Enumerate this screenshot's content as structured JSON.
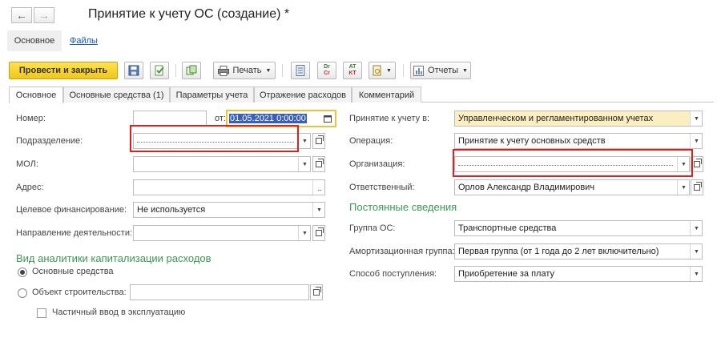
{
  "window": {
    "title": "Принятие к учету ОС (создание) *"
  },
  "doc_nav": {
    "main": "Основное",
    "files": "Файлы"
  },
  "toolbar": {
    "post_and_close": "Провести и закрыть",
    "print": "Печать",
    "dr_label": "Dr",
    "cr_label": "Cr",
    "at_label": "AT",
    "kt_label": "KT",
    "reports": "Отчеты"
  },
  "tabs": [
    {
      "label": "Основное"
    },
    {
      "label": "Основные средства (1)"
    },
    {
      "label": "Параметры учета"
    },
    {
      "label": "Отражение расходов"
    },
    {
      "label": "Комментарий"
    }
  ],
  "form": {
    "number_label": "Номер:",
    "number_value": "",
    "from_label": "от:",
    "date_value": "01.05.2021  0:00:00",
    "department_label": "Подразделение:",
    "department_value": "",
    "mol_label": "МОЛ:",
    "mol_value": "",
    "address_label": "Адрес:",
    "address_value": "",
    "financing_label": "Целевое финансирование:",
    "financing_value": "Не используется",
    "direction_label": "Направление деятельности:",
    "direction_value": "",
    "analytics_title": "Вид аналитики капитализации расходов",
    "radio_fixed_assets": "Основные средства",
    "radio_construction": "Объект строительства:",
    "construction_value": "",
    "partial_commissioning": "Частичный ввод в эксплуатацию",
    "acceptance_label": "Принятие к учету в:",
    "acceptance_value": "Управленческом и регламентированном учетах",
    "operation_label": "Операция:",
    "operation_value": "Принятие к учету основных средств",
    "organization_label": "Организация:",
    "organization_value": "",
    "responsible_label": "Ответственный:",
    "responsible_value": "Орлов Александр Владимирович",
    "permanent_title": "Постоянные сведения",
    "os_group_label": "Группа ОС:",
    "os_group_value": "Транспортные средства",
    "depr_group_label": "Амортизационная группа:",
    "depr_group_value": "Первая группа (от 1 года до 2 лет включительно)",
    "receipt_method_label": "Способ поступления:",
    "receipt_method_value": "Приобретение за плату"
  },
  "colors": {
    "accent_button": "#f2c715",
    "section_title": "#3a9a52",
    "highlight_box": "#e02020",
    "link": "#1a55b5"
  }
}
